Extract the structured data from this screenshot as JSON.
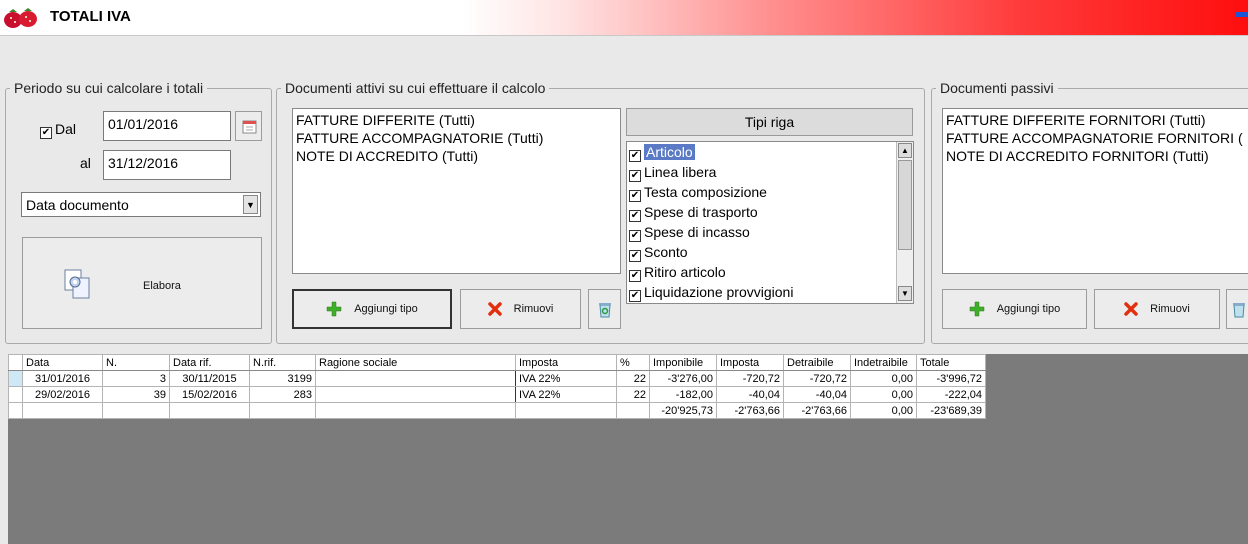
{
  "window": {
    "title": "TOTALI IVA"
  },
  "periodo": {
    "legend": "Periodo su cui calcolare i totali",
    "dal_label": "Dal",
    "dal_value": "01/01/2016",
    "al_label": "al",
    "al_value": "31/12/2016",
    "tipo_data": "Data documento",
    "elabora_label": "Elabora"
  },
  "attivi": {
    "legend": "Documenti attivi su cui effettuare il calcolo",
    "items": [
      "FATTURE DIFFERITE (Tutti)",
      "FATTURE ACCOMPAGNATORIE (Tutti)",
      "NOTE DI ACCREDITO (Tutti)"
    ],
    "aggiungi_label": "Aggiungi tipo",
    "rimuovi_label": "Rimuovi"
  },
  "tipi_riga": {
    "header": "Tipi riga",
    "items": [
      "Articolo",
      "Linea libera",
      "Testa composizione",
      "Spese di trasporto",
      "Spese di incasso",
      "Sconto",
      "Ritiro articolo",
      "Liquidazione provvigioni"
    ]
  },
  "passivi": {
    "legend": "Documenti passivi",
    "items": [
      "FATTURE DIFFERITE FORNITORI (Tutti)",
      "FATTURE ACCOMPAGNATORIE FORNITORI (",
      "NOTE DI ACCREDITO FORNITORI (Tutti)"
    ],
    "aggiungi_label": "Aggiungi tipo",
    "rimuovi_label": "Rimuovi"
  },
  "grid": {
    "columns": [
      "Data",
      "N.",
      "Data rif.",
      "N.rif.",
      "Ragione sociale",
      "Imposta",
      "%",
      "Imponibile",
      "Imposta",
      "Detraibile",
      "Indetraibile",
      "Totale"
    ],
    "rows": [
      [
        "31/01/2016",
        "3",
        "30/11/2015",
        "3199",
        "",
        "IVA 22%",
        "22",
        "-3'276,00",
        "-720,72",
        "-720,72",
        "0,00",
        "-3'996,72"
      ],
      [
        "29/02/2016",
        "39",
        "15/02/2016",
        "283",
        "",
        "IVA 22%",
        "22",
        "-182,00",
        "-40,04",
        "-40,04",
        "0,00",
        "-222,04"
      ],
      [
        "",
        "",
        "",
        "",
        "",
        "",
        "",
        "-20'925,73",
        "-2'763,66",
        "-2'763,66",
        "0,00",
        "-23'689,39"
      ]
    ]
  },
  "colors": {
    "title_gradient_end": "#ff0e0e",
    "selection": "#5a7ac5",
    "grid_bg": "#7b7b7b"
  }
}
